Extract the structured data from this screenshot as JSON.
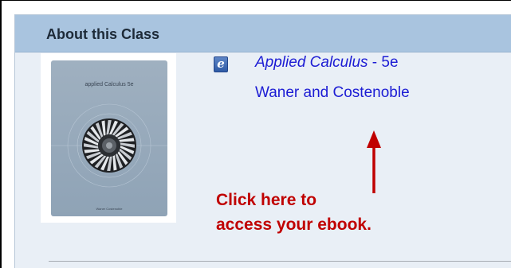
{
  "panel": {
    "title": "About this Class"
  },
  "book": {
    "cover": {
      "title_text": "applied Calculus 5e",
      "author_text": "Waner Costenoble"
    },
    "icon": "ebook-icon",
    "icon_glyph": "e",
    "title": "Applied Calculus",
    "edition": " - 5e",
    "authors": "Waner and Costenoble"
  },
  "annotation": {
    "line1": "Click here to",
    "line2": "access your ebook.",
    "color": "#c00000"
  },
  "colors": {
    "header_bg": "#a9c4df",
    "panel_bg": "#e9eff6",
    "link": "#1c1cd4"
  }
}
